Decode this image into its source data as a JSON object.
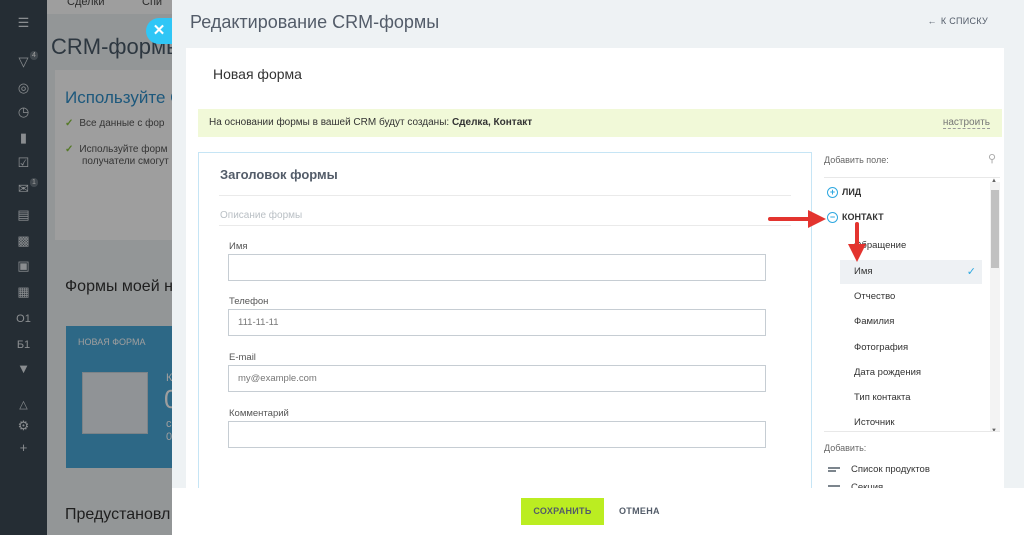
{
  "sidebar": {
    "icons": [
      "menu-icon",
      "filter-icon",
      "target-icon",
      "clock-icon",
      "chart-icon",
      "check-icon",
      "mail-icon",
      "inbox-icon",
      "cart-icon",
      "window-icon",
      "grid-icon",
      "text-o1",
      "text-b1",
      "chevron-icon",
      "tree-icon",
      "gear-icon",
      "plus-icon"
    ],
    "badge_filter": "4",
    "badge_mail": "1",
    "o1": "О1",
    "b1": "Б1"
  },
  "background": {
    "tab1": "Сделки",
    "tab2": "Спи",
    "title": "CRM-формы",
    "title_suffix": "(",
    "promo_title": "Используйте С",
    "check1": "Все данные с фор",
    "check2_line1": "Используйте форм",
    "check2_line2": "получатели смогут",
    "my_forms": "Формы моей н",
    "form_card_label": "НОВАЯ ФОРМА",
    "form_card_k": "К",
    "form_card_zero": "0",
    "form_card_c": "с",
    "form_card_0": "0",
    "preset": "Предустановл"
  },
  "header": {
    "title": "Редактирование CRM-формы",
    "to_list": "К СПИСКУ"
  },
  "form": {
    "name": "Новая форма",
    "info_prefix": "На основании формы в вашей CRM будут созданы: ",
    "info_entities": "Сделка, Контакт",
    "setup_link": "настроить",
    "title": "Заголовок формы",
    "description_placeholder": "Описание формы",
    "fields": [
      {
        "label": "Имя",
        "value": ""
      },
      {
        "label": "Телефон",
        "value": "111-11-11"
      },
      {
        "label": "E-mail",
        "value": "my@example.com"
      },
      {
        "label": "Комментарий",
        "value": ""
      }
    ]
  },
  "side": {
    "add_field_label": "Добавить поле:",
    "sections": [
      {
        "name": "ЛИД",
        "icon": "plus"
      },
      {
        "name": "КОНТАКТ",
        "icon": "minus"
      }
    ],
    "items": [
      "Обращение",
      "Имя",
      "Отчество",
      "Фамилия",
      "Фотография",
      "Дата рождения",
      "Тип контакта",
      "Источник"
    ],
    "selected_item": "Имя",
    "add_label": "Добавить:",
    "add_items": [
      "Список продуктов",
      "Секция"
    ]
  },
  "footer": {
    "save": "СОХРАНИТЬ",
    "cancel": "ОТМЕНА"
  },
  "colors": {
    "accent": "#2fc6f6",
    "save": "#bbed21",
    "info_bg": "#f1f9d8",
    "arrow": "#e3342f"
  }
}
